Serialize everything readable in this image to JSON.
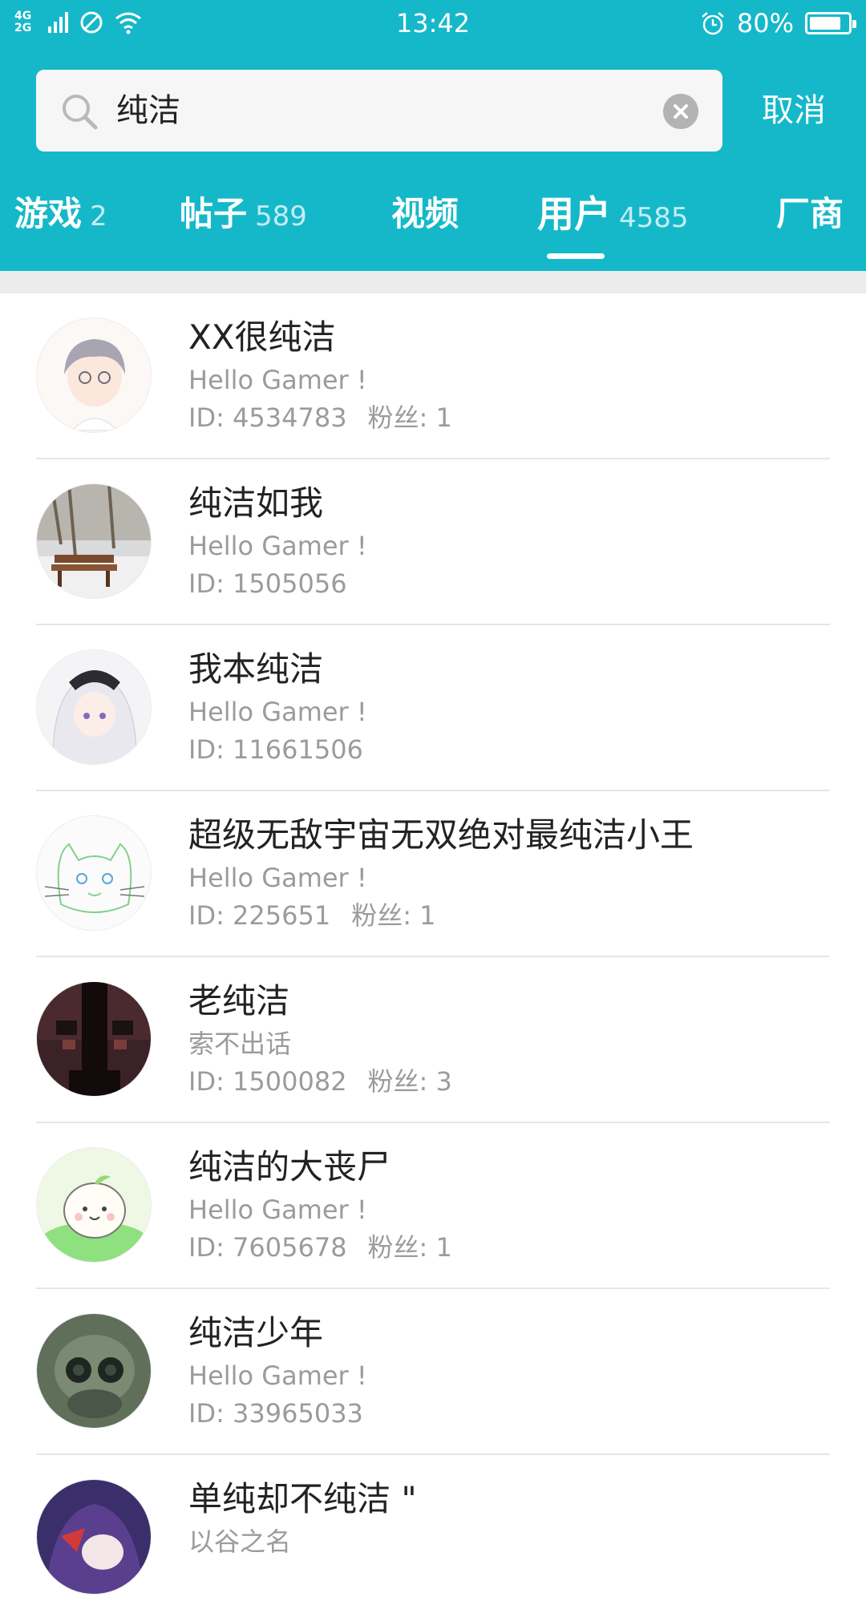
{
  "status_bar": {
    "network_top": "4G",
    "network_bottom": "2G",
    "time": "13:42",
    "battery": "80%"
  },
  "search": {
    "query": "纯洁",
    "cancel_label": "取消"
  },
  "tabs": [
    {
      "label": "游戏",
      "count": "2"
    },
    {
      "label": "帖子",
      "count": "589"
    },
    {
      "label": "视频",
      "count": ""
    },
    {
      "label": "用户",
      "count": "4585"
    },
    {
      "label": "厂商",
      "count": ""
    }
  ],
  "active_tab": "用户",
  "users": [
    {
      "name": "XX很纯洁",
      "bio": "Hello Gamer !",
      "id": "ID: 4534783",
      "fans": "粉丝: 1"
    },
    {
      "name": "纯洁如我",
      "bio": "Hello Gamer !",
      "id": "ID: 1505056",
      "fans": ""
    },
    {
      "name": "我本纯洁",
      "bio": "Hello Gamer !",
      "id": "ID: 11661506",
      "fans": ""
    },
    {
      "name": "超级无敌宇宙无双绝对最纯洁小王",
      "bio": "Hello Gamer !",
      "id": "ID: 225651",
      "fans": "粉丝: 1"
    },
    {
      "name": "老纯洁",
      "bio": "索不出话",
      "id": "ID: 1500082",
      "fans": "粉丝: 3"
    },
    {
      "name": "纯洁的大丧尸",
      "bio": "Hello Gamer !",
      "id": "ID: 7605678",
      "fans": "粉丝: 1"
    },
    {
      "name": "纯洁少年",
      "bio": "Hello Gamer !",
      "id": "ID: 33965033",
      "fans": ""
    },
    {
      "name": "单纯却不纯洁 \"",
      "bio": "以谷之名",
      "id": "",
      "fans": ""
    }
  ],
  "colors": {
    "header": "#15b8c9",
    "divider": "#e6e6e6",
    "secondary_text": "#9b9b9b"
  },
  "icons": [
    "search-icon",
    "clear-icon",
    "signal-icon",
    "no-sim-icon",
    "wifi-icon",
    "alarm-icon",
    "battery-icon"
  ]
}
